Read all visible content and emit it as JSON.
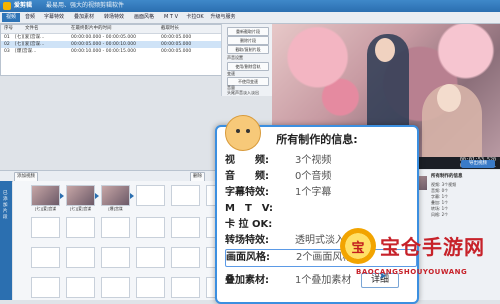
{
  "app": {
    "title": "爱剪辑",
    "slogan": "最易用、强大的视频剪辑软件"
  },
  "menu": {
    "tabs": [
      "视频",
      "音频",
      "字幕特效",
      "叠加素材",
      "转场特效",
      "画面风格",
      "M T V",
      "卡拉OK",
      "升级与服务"
    ]
  },
  "file_list": {
    "headers": [
      "序号",
      "文件名",
      "在最终影片中的时间",
      "截取时长"
    ],
    "rows": [
      {
        "idx": "01",
        "name": "[七][爱]宫谋...",
        "time": "00:00:00.000 - 00:00:05.000",
        "dur": "00:00:05.000",
        "selected": false
      },
      {
        "idx": "02",
        "name": "[七][爱]宫谋...",
        "time": "00:00:05.000 - 00:00:10.000",
        "dur": "00:00:05.000",
        "selected": true
      },
      {
        "idx": "03",
        "name": "[爆]宫谋...",
        "time": "00:00:10.000 - 00:00:15.000",
        "dur": "00:00:05.000",
        "selected": false
      }
    ]
  },
  "controls": {
    "items": [
      "重新截取片段",
      "删除片段",
      "截取/复制片段",
      "声音设置",
      "使用/删除音轨",
      "变速",
      "不使用变速",
      "音量",
      "头尾声音淡入淡出"
    ]
  },
  "preview": {
    "time_current": "00:01:53.520",
    "time_total": "00:46:50.891"
  },
  "lower_toolbar": {
    "add_video": "添加视频",
    "delete": "删除"
  },
  "side_label": "已添加片段",
  "thumbs": {
    "captions": [
      "[七][爱]宫谋",
      "[七][爱]宫谋",
      "[爆]宫谋"
    ]
  },
  "right_panel": {
    "title": "所有制作的信息",
    "button": "导出视频",
    "lines": [
      "视频: 3个视频",
      "音频: 0个",
      "字幕: 1个",
      "叠加: 1个",
      "转场: 1个",
      "风格: 2个"
    ]
  },
  "popup": {
    "title": "所有制作的信息:",
    "rows": [
      {
        "k": "视　　频:",
        "v": "3个视频"
      },
      {
        "k": "音　　频:",
        "v": "0个音频"
      },
      {
        "k": "字幕特效:",
        "v": "1个字幕"
      },
      {
        "k": "M　T　V:",
        "v": ""
      },
      {
        "k": "卡 拉 OK:",
        "v": ""
      },
      {
        "k": "转场特效:",
        "v": "透明式淡入淡出"
      },
      {
        "k": "画面风格:",
        "v": "2个画面风格"
      },
      {
        "k": "叠加素材:",
        "v": "1个叠加素材"
      }
    ],
    "detail_button": "详细"
  },
  "watermark": {
    "logo_char": "宝",
    "name": "宝仓手游网",
    "url": "BAOCANGSHOUYOUWANG"
  }
}
